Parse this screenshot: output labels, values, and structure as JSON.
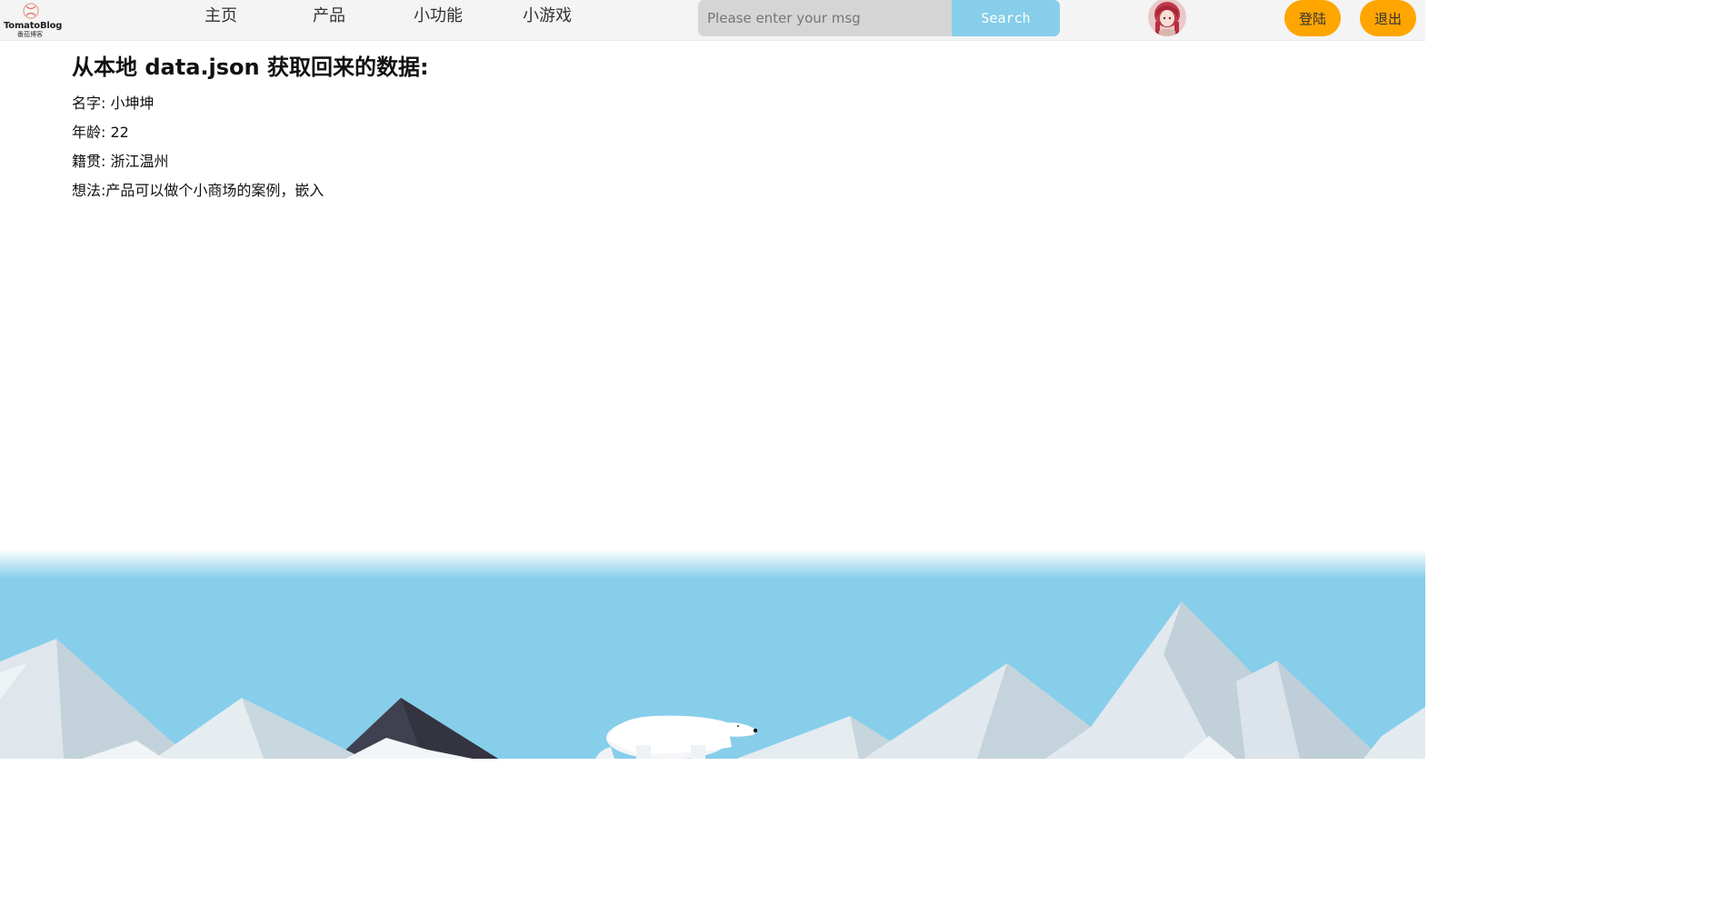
{
  "header": {
    "logo": {
      "name": "TomatoBlog",
      "subtitle": "番茄博客"
    },
    "nav": [
      {
        "label": "主页"
      },
      {
        "label": "产品"
      },
      {
        "label": "小功能"
      },
      {
        "label": "小游戏"
      }
    ],
    "search": {
      "placeholder": "Please enter your msg",
      "value": "",
      "button_label": "Search"
    },
    "buttons": {
      "login_label": "登陆",
      "logout_label": "退出"
    }
  },
  "main": {
    "heading": "从本地 data.json 获取回来的数据:",
    "rows": [
      {
        "text": "名字: 小坤坤"
      },
      {
        "text": "年龄: 22"
      },
      {
        "text": "籍贯: 浙江温州"
      },
      {
        "text": "想法:产品可以做个小商场的案例，嵌入"
      }
    ]
  },
  "colors": {
    "nav_background": "#f4f4f4",
    "search_button": "#87ceeb",
    "pill_buttons": "#ffa500",
    "sky": "#87ceeb"
  }
}
